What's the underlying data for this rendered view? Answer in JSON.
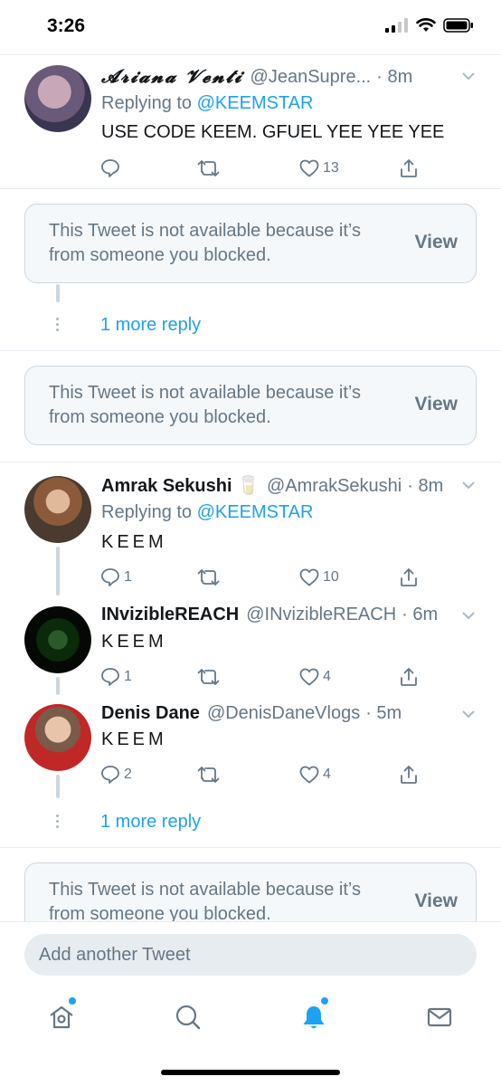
{
  "status_bar": {
    "time": "3:26"
  },
  "tweets": [
    {
      "name": "𝓐𝓻𝓲𝓪𝓷𝓪 𝓥𝓮𝓷𝓽𝓲",
      "handle": "@JeanSupre...",
      "time": "· 8m",
      "reply_prefix": "Replying to",
      "reply_handle": "@KEEMSTAR",
      "text": "USE CODE KEEM. GFUEL YEE YEE YEE",
      "replies": "",
      "retweets": "",
      "likes": "13"
    },
    {
      "name": "Amrak Sekushi 🥛",
      "handle": "@AmrakSekushi",
      "time": "· 8m",
      "reply_prefix": "Replying to",
      "reply_handle": "@KEEMSTAR",
      "text": "KEEM",
      "replies": "1",
      "retweets": "",
      "likes": "10"
    },
    {
      "name": "INvizibleREACH",
      "handle": "@INvizibleREACH",
      "time": "· 6m",
      "text": "KEEM",
      "replies": "1",
      "retweets": "",
      "likes": "4"
    },
    {
      "name": "Denis Dane",
      "handle": "@DenisDaneVlogs",
      "time": "· 5m",
      "text": "KEEM",
      "replies": "2",
      "retweets": "",
      "likes": "4"
    }
  ],
  "blocked": {
    "text": "This Tweet is not available because it’s from someone you blocked.",
    "view_label": "View"
  },
  "more_reply_label": "1 more reply",
  "compose": {
    "placeholder": "Add another Tweet"
  },
  "tabs": [
    "home-icon",
    "search-icon",
    "notifications-icon",
    "messages-icon"
  ],
  "colors": {
    "accent": "#1da1f2",
    "secondary_text": "#657786",
    "card_bg": "#f5f8fa"
  }
}
